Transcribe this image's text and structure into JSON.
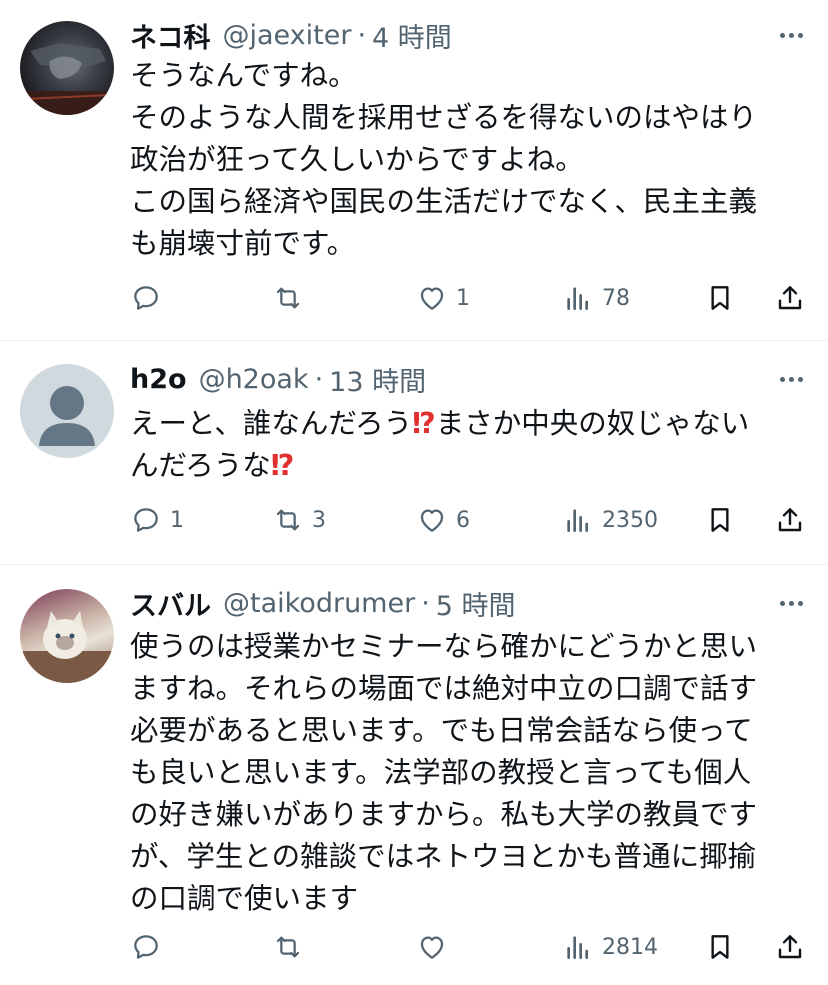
{
  "posts": [
    {
      "name": "ネコ科",
      "handle": "@jaexiter",
      "time": "4 時間",
      "lines": [
        "そうなんですね。",
        "そのような人間を採用せざるを得ないのはやはり",
        "政治が狂って久しいからですよね。",
        "この国ら経済や国民の生活だけでなく、民主主義",
        "も崩壊寸前です。"
      ],
      "actions": {
        "reply": "",
        "repost": "",
        "like": "1",
        "views": "78"
      }
    },
    {
      "name": "h2o",
      "handle": "@h2oak",
      "time": "13 時間",
      "line1_a": "えーと、誰なんだろう",
      "line1_b": "まさか中央の奴じゃない",
      "line2_a": "んだろうな",
      "emoji": "⁉",
      "actions": {
        "reply": "1",
        "repost": "3",
        "like": "6",
        "views": "2350"
      }
    },
    {
      "name": "スバル",
      "handle": "@taikodrumer",
      "time": "5 時間",
      "lines": [
        "使うのは授業かセミナーなら確かにどうかと思い",
        "ますね。それらの場面では絶対中立の口調で話す",
        "必要があると思います。でも日常会話なら使って",
        "も良いと思います。法学部の教授と言っても個人",
        "の好き嫌いがありますから。私も大学の教員です",
        "が、学生との雑談ではネトウヨとかも普通に揶揄",
        "の口調で使います"
      ],
      "actions": {
        "reply": "",
        "repost": "",
        "like": "",
        "views": "2814"
      }
    }
  ],
  "icons": [
    "reply-icon",
    "repost-icon",
    "like-icon",
    "views-icon",
    "bookmark-icon",
    "share-icon",
    "more-icon"
  ],
  "colors": {
    "text": "#0f1419",
    "secondary": "#536471",
    "divider": "#eff3f4",
    "emoji": "#e0302f"
  }
}
